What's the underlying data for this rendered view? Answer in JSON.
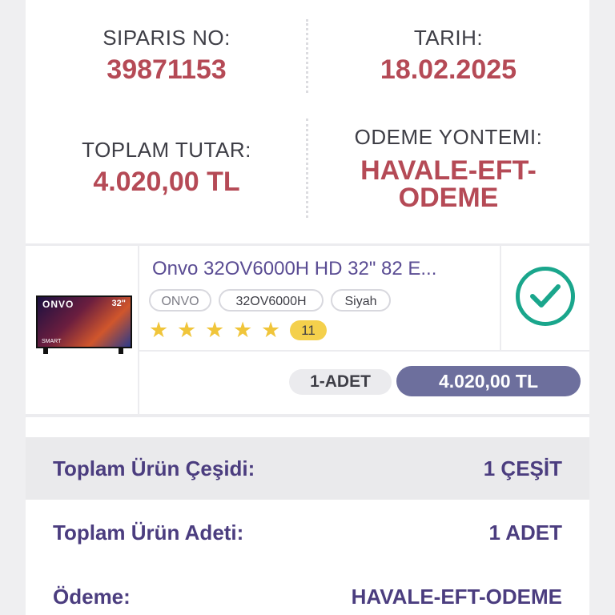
{
  "order": {
    "number_label": "SIPARIS NO:",
    "number_value": "39871153",
    "date_label": "TARIH:",
    "date_value": "18.02.2025",
    "total_label": "TOPLAM TUTAR:",
    "total_value": "4.020,00 TL",
    "payment_label": "ODEME YONTEMI:",
    "payment_value_line1": "HAVALE-EFT-",
    "payment_value_line2": "ODEME"
  },
  "product": {
    "title": "Onvo 32OV6000H HD 32\" 82 E...",
    "image_brand": "ONVO",
    "image_size": "32\"",
    "image_caption": "SMART",
    "chips": {
      "brand": "ONVO",
      "model": "32OV6000H",
      "color": "Siyah"
    },
    "rating": {
      "stars": 5,
      "count": "11"
    },
    "quantity": "1-ADET",
    "price": "4.020,00 TL",
    "status_icon": "check-circle-icon"
  },
  "summary": {
    "variety_label": "Toplam Ürün Çeşidi:",
    "variety_value": "1 ÇEŞİT",
    "count_label": "Toplam Ürün Adeti:",
    "count_value": "1 ADET",
    "payment_label": "Ödeme:",
    "payment_value": "HAVALE-EFT-ODEME"
  },
  "colors": {
    "accent_red": "#b54a56",
    "accent_purple": "#4b3d7f",
    "success_green": "#1aa68c",
    "price_pill": "#6d6f9d",
    "star_yellow": "#f0c53a"
  }
}
